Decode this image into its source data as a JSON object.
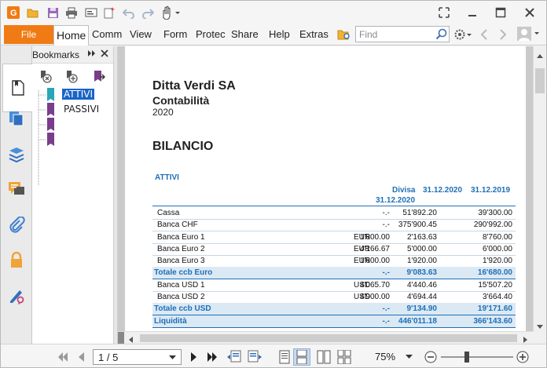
{
  "toolbar": {
    "quick_access_icons": [
      "app-logo-icon",
      "open-icon",
      "save-icon",
      "print-icon",
      "email-icon",
      "new-icon",
      "undo-icon",
      "redo-icon",
      "hand-tool-icon"
    ],
    "window_controls": [
      "restore-icon",
      "minimize-icon",
      "maximize-icon",
      "close-icon"
    ]
  },
  "menu": {
    "file": "File",
    "items": [
      "Home",
      "Comm",
      "View",
      "Form",
      "Protec",
      "Share",
      "Help",
      "Extras"
    ],
    "active": "Home",
    "search_placeholder": "Find"
  },
  "sidebar": {
    "title": "Bookmarks",
    "tabs": [
      "bookmarks-icon",
      "pages-icon",
      "layers-icon",
      "comments-icon",
      "attachments-icon",
      "security-icon",
      "signature-icon"
    ],
    "tools": [
      "delete-bookmark-icon",
      "add-bookmark-icon",
      "bookmark-properties-icon"
    ],
    "bookmarks": [
      {
        "label": "ATTIVI",
        "selected": true,
        "color": "#2aa6b8"
      },
      {
        "label": "PASSIVI",
        "selected": false,
        "color": "#7a3d8c"
      },
      {
        "label": "",
        "selected": false,
        "color": "#7a3d8c"
      },
      {
        "label": "",
        "selected": false,
        "color": "#7a3d8c"
      }
    ]
  },
  "document": {
    "company": "Ditta Verdi SA",
    "subtitle": "Contabilità",
    "year": "2020",
    "heading": "BILANCIO",
    "section": "ATTIVI",
    "columns": {
      "divisa_line1": "Divisa",
      "divisa_line2": "31.12.2020",
      "col2020": "31.12.2020",
      "col2019": "31.12.2019"
    },
    "rows": [
      {
        "label": "Cassa",
        "cur": "",
        "divisa": "-.-",
        "v2020": "51'892.20",
        "v2019": "39'300.00",
        "band": false
      },
      {
        "label": "Banca CHF",
        "cur": "",
        "divisa": "-.-",
        "v2020": "375'900.45",
        "v2019": "290'992.00",
        "band": false
      },
      {
        "label": "Banca Euro 1",
        "cur": "EUR",
        "divisa": "1'800.00",
        "v2020": "2'163.63",
        "v2019": "8'760.00",
        "band": false
      },
      {
        "label": "Banca Euro 2",
        "cur": "EUR",
        "divisa": "4'166.67",
        "v2020": "5'000.00",
        "v2019": "6'000.00",
        "band": false
      },
      {
        "label": "Banca Euro 3",
        "cur": "EUR",
        "divisa": "1'600.00",
        "v2020": "1'920.00",
        "v2019": "1'920.00",
        "band": false
      },
      {
        "label": "Totale ccb Euro",
        "cur": "",
        "divisa": "-.-",
        "v2020": "9'083.63",
        "v2019": "16'680.00",
        "band": true
      },
      {
        "label": "Banca USD 1",
        "cur": "USD",
        "divisa": "4'065.70",
        "v2020": "4'440.46",
        "v2019": "15'507.20",
        "band": false
      },
      {
        "label": "Banca USD 2",
        "cur": "USD",
        "divisa": "4'900.00",
        "v2020": "4'694.44",
        "v2019": "3'664.40",
        "band": false
      },
      {
        "label": "Totale ccb USD",
        "cur": "",
        "divisa": "-.-",
        "v2020": "9'134.90",
        "v2019": "19'171.60",
        "band": true
      },
      {
        "label": "Liquidità",
        "cur": "",
        "divisa": "-.-",
        "v2020": "446'011.18",
        "v2019": "366'143.60",
        "band": true
      }
    ]
  },
  "status": {
    "page_indicator": "1 / 5",
    "zoom": "75%"
  }
}
